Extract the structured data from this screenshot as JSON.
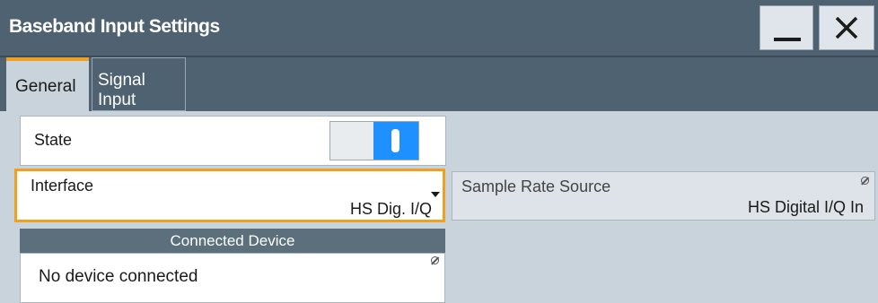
{
  "window": {
    "title": "Baseband Input Settings"
  },
  "tabs": [
    {
      "label": "General",
      "active": true
    },
    {
      "label": "Signal Input",
      "active": false
    }
  ],
  "state": {
    "label": "State",
    "on": true
  },
  "interface": {
    "label": "Interface",
    "value": "HS Dig. I/Q"
  },
  "sample_rate_source": {
    "label": "Sample Rate Source",
    "value": "HS Digital I/Q In"
  },
  "connected_device": {
    "header": "Connected Device",
    "status": "No device connected"
  },
  "colors": {
    "accent": "#f0a01e",
    "toggle_on": "#1e90ff",
    "titlebar": "#4e6271"
  }
}
